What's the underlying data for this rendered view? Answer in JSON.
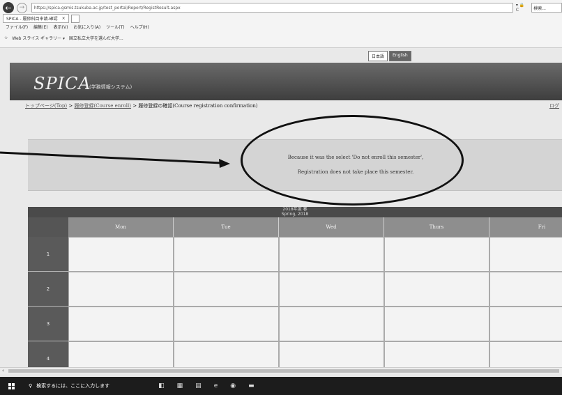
{
  "browser": {
    "address": "https://spica.gsmis.tsukuba.ac.jp/test_portal/Report/RegistResult.aspx",
    "address_controls": "▾ 🔒 C",
    "search_placeholder": "検索...",
    "tab_title": "SPICA - 履修科目申請-確認",
    "tab_close": "×",
    "menu": [
      "ファイル(F)",
      "編集(E)",
      "表示(V)",
      "お気に入り(A)",
      "ツール(T)",
      "ヘルプ(H)"
    ],
    "favorites": [
      "Web スライス ギャラリー ▾",
      "国立私立大学を選んだ大学..."
    ]
  },
  "lang": {
    "ja": "日本語",
    "en": "English"
  },
  "header": {
    "logo": "SPICA",
    "logo_sub": "(学務情報システム)"
  },
  "breadcrumb": {
    "home": "トップページ(Top)",
    "sep1": " > ",
    "course": "履修登録(Course enroll)",
    "sep2": " > ",
    "current": "履修登録の確認(Course registration confirmation)",
    "right_link": "ログ"
  },
  "message": {
    "line1": "Because it was the select 'Do not enroll this semester',",
    "line2": "Registration does not take place this semester."
  },
  "timetable": {
    "title_line1": "2018年度 春",
    "title_line2": "Spring, 2018",
    "days": [
      "Mon",
      "Tue",
      "Wed",
      "Thurs",
      "Fri"
    ],
    "periods": [
      "1",
      "2",
      "3",
      "4"
    ]
  },
  "scrollbar": {
    "left_arrow": "‹"
  },
  "taskbar": {
    "search_placeholder": "検索するには、ここに入力します"
  },
  "colors": {
    "banner": "#4a4a4a",
    "panel": "#d4d4d4",
    "table_header": "#8e8e8e",
    "taskbar": "#1c1c1c"
  }
}
